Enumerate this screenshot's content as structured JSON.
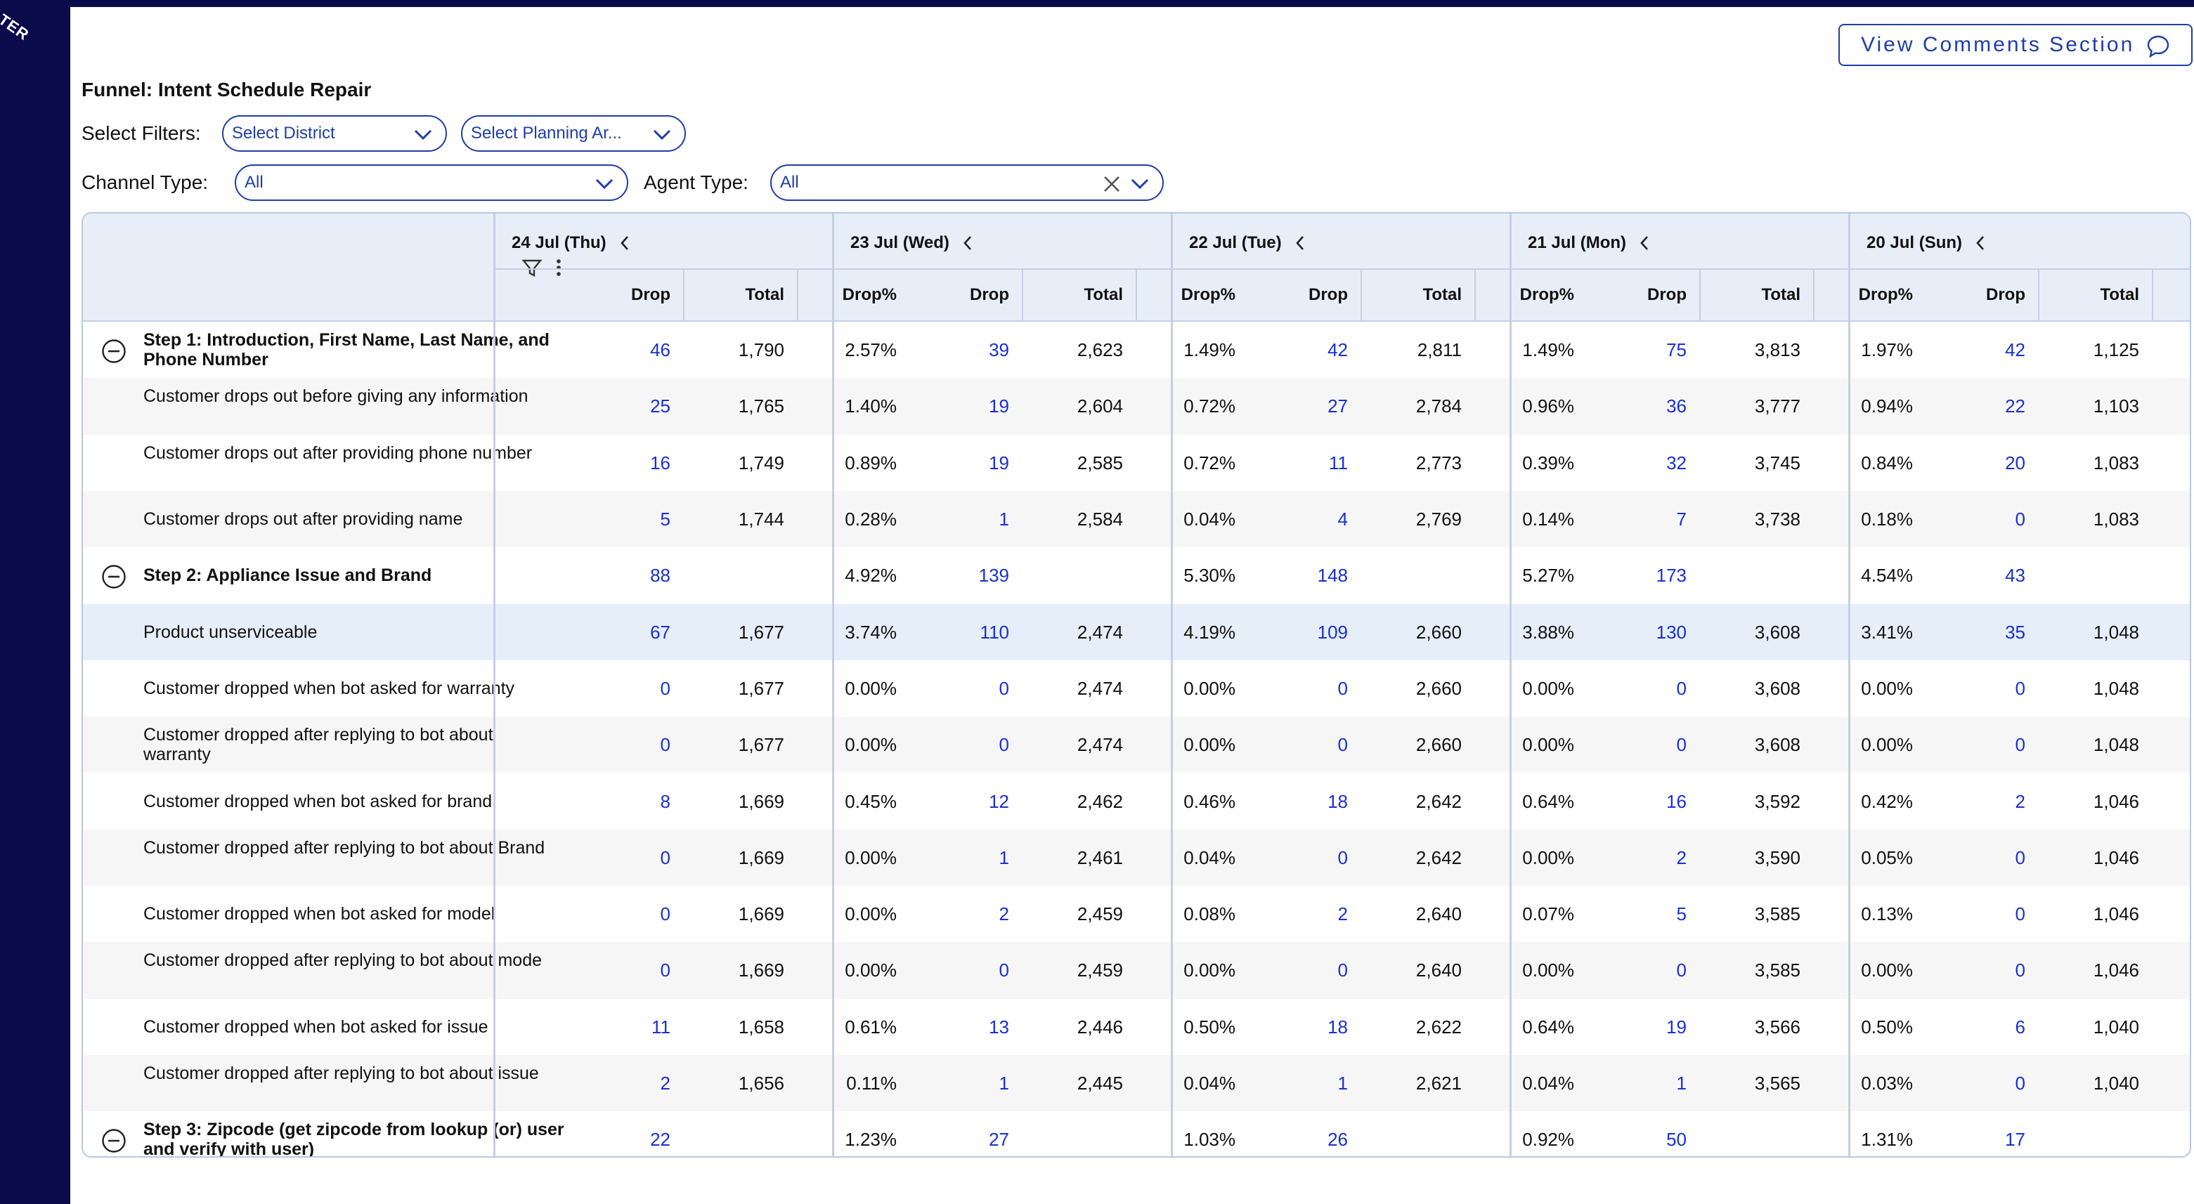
{
  "sidebar": {
    "logo_fragment": "TER"
  },
  "header": {
    "comments_button": "View Comments Section",
    "comment_icon": "comment-icon"
  },
  "funnel": {
    "title": "Funnel: Intent Schedule Repair"
  },
  "filters": {
    "select_label": "Select Filters:",
    "district": "Select District",
    "planning_area": "Select Planning Ar...",
    "channel_label": "Channel Type:",
    "channel_value": "All",
    "agent_label": "Agent Type:",
    "agent_value": "All"
  },
  "table": {
    "dates": [
      "24 Jul (Thu)",
      "23 Jul (Wed)",
      "22 Jul (Tue)",
      "21 Jul (Mon)",
      "20 Jul (Sun)"
    ],
    "col_headers": {
      "drop": "Drop",
      "total": "Total",
      "drop_pct": "Drop%"
    },
    "rows": [
      {
        "label": "Step 1: Introduction, First Name, Last Name, and Phone Number",
        "step": true,
        "cells": [
          [
            "46",
            "1,790",
            "2.57%"
          ],
          [
            "39",
            "2,623",
            "1.49%"
          ],
          [
            "42",
            "2,811",
            "1.49%"
          ],
          [
            "75",
            "3,813",
            "1.97%"
          ],
          [
            "42",
            "1,125",
            ""
          ]
        ]
      },
      {
        "label": "Customer drops out before giving any information",
        "step": false,
        "cells": [
          [
            "25",
            "1,765",
            "1.40%"
          ],
          [
            "19",
            "2,604",
            "0.72%"
          ],
          [
            "27",
            "2,784",
            "0.96%"
          ],
          [
            "36",
            "3,777",
            "0.94%"
          ],
          [
            "22",
            "1,103",
            ""
          ]
        ]
      },
      {
        "label": "Customer drops out after providing phone number",
        "step": false,
        "cells": [
          [
            "16",
            "1,749",
            "0.89%"
          ],
          [
            "19",
            "2,585",
            "0.72%"
          ],
          [
            "11",
            "2,773",
            "0.39%"
          ],
          [
            "32",
            "3,745",
            "0.84%"
          ],
          [
            "20",
            "1,083",
            ""
          ]
        ]
      },
      {
        "label": "Customer drops out after providing name",
        "step": false,
        "cells": [
          [
            "5",
            "1,744",
            "0.28%"
          ],
          [
            "1",
            "2,584",
            "0.04%"
          ],
          [
            "4",
            "2,769",
            "0.14%"
          ],
          [
            "7",
            "3,738",
            "0.18%"
          ],
          [
            "0",
            "1,083",
            ""
          ]
        ]
      },
      {
        "label": "Step 2: Appliance Issue and Brand",
        "step": true,
        "cells": [
          [
            "88",
            "",
            "4.92%"
          ],
          [
            "139",
            "",
            "5.30%"
          ],
          [
            "148",
            "",
            "5.27%"
          ],
          [
            "173",
            "",
            "4.54%"
          ],
          [
            "43",
            "",
            ""
          ]
        ]
      },
      {
        "label": "Product unserviceable",
        "step": false,
        "selected": true,
        "cells": [
          [
            "67",
            "1,677",
            "3.74%"
          ],
          [
            "110",
            "2,474",
            "4.19%"
          ],
          [
            "109",
            "2,660",
            "3.88%"
          ],
          [
            "130",
            "3,608",
            "3.41%"
          ],
          [
            "35",
            "1,048",
            ""
          ]
        ]
      },
      {
        "label": "Customer dropped when bot asked for warranty",
        "step": false,
        "cells": [
          [
            "0",
            "1,677",
            "0.00%"
          ],
          [
            "0",
            "2,474",
            "0.00%"
          ],
          [
            "0",
            "2,660",
            "0.00%"
          ],
          [
            "0",
            "3,608",
            "0.00%"
          ],
          [
            "0",
            "1,048",
            ""
          ]
        ]
      },
      {
        "label": "Customer dropped after replying to bot about warranty",
        "step": false,
        "cells": [
          [
            "0",
            "1,677",
            "0.00%"
          ],
          [
            "0",
            "2,474",
            "0.00%"
          ],
          [
            "0",
            "2,660",
            "0.00%"
          ],
          [
            "0",
            "3,608",
            "0.00%"
          ],
          [
            "0",
            "1,048",
            ""
          ]
        ]
      },
      {
        "label": "Customer dropped when bot asked for brand",
        "step": false,
        "cells": [
          [
            "8",
            "1,669",
            "0.45%"
          ],
          [
            "12",
            "2,462",
            "0.46%"
          ],
          [
            "18",
            "2,642",
            "0.64%"
          ],
          [
            "16",
            "3,592",
            "0.42%"
          ],
          [
            "2",
            "1,046",
            ""
          ]
        ]
      },
      {
        "label": "Customer dropped after replying to bot about Brand",
        "step": false,
        "cells": [
          [
            "0",
            "1,669",
            "0.00%"
          ],
          [
            "1",
            "2,461",
            "0.04%"
          ],
          [
            "0",
            "2,642",
            "0.00%"
          ],
          [
            "2",
            "3,590",
            "0.05%"
          ],
          [
            "0",
            "1,046",
            ""
          ]
        ]
      },
      {
        "label": "Customer dropped when bot asked for model",
        "step": false,
        "cells": [
          [
            "0",
            "1,669",
            "0.00%"
          ],
          [
            "2",
            "2,459",
            "0.08%"
          ],
          [
            "2",
            "2,640",
            "0.07%"
          ],
          [
            "5",
            "3,585",
            "0.13%"
          ],
          [
            "0",
            "1,046",
            ""
          ]
        ]
      },
      {
        "label": "Customer dropped after replying to bot about mode",
        "step": false,
        "cells": [
          [
            "0",
            "1,669",
            "0.00%"
          ],
          [
            "0",
            "2,459",
            "0.00%"
          ],
          [
            "0",
            "2,640",
            "0.00%"
          ],
          [
            "0",
            "3,585",
            "0.00%"
          ],
          [
            "0",
            "1,046",
            ""
          ]
        ]
      },
      {
        "label": "Customer dropped when bot asked for issue",
        "step": false,
        "cells": [
          [
            "11",
            "1,658",
            "0.61%"
          ],
          [
            "13",
            "2,446",
            "0.50%"
          ],
          [
            "18",
            "2,622",
            "0.64%"
          ],
          [
            "19",
            "3,566",
            "0.50%"
          ],
          [
            "6",
            "1,040",
            ""
          ]
        ]
      },
      {
        "label": "Customer dropped after replying to bot about issue",
        "step": false,
        "cells": [
          [
            "2",
            "1,656",
            "0.11%"
          ],
          [
            "1",
            "2,445",
            "0.04%"
          ],
          [
            "1",
            "2,621",
            "0.04%"
          ],
          [
            "1",
            "3,565",
            "0.03%"
          ],
          [
            "0",
            "1,040",
            ""
          ]
        ]
      },
      {
        "label": "Step 3: Zipcode (get zipcode from lookup (or) user and verify with user)",
        "step": true,
        "cells": [
          [
            "22",
            "",
            "1.23%"
          ],
          [
            "27",
            "",
            "1.03%"
          ],
          [
            "26",
            "",
            "0.92%"
          ],
          [
            "50",
            "",
            "1.31%"
          ],
          [
            "17",
            "",
            ""
          ]
        ]
      }
    ]
  },
  "colors": {
    "navy": "#0a0b4a",
    "link_blue": "#1a2fd4",
    "border_blue": "#1f3ea8",
    "header_bg": "#e8eef8"
  }
}
